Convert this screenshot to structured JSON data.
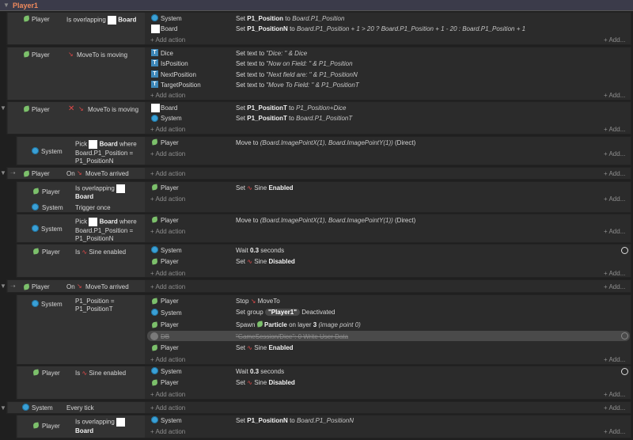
{
  "group": {
    "title": "Player1"
  },
  "common": {
    "add_action": "+ Add action",
    "add_dots": "+ Add...",
    "player": "Player",
    "system": "System",
    "board": "Board"
  },
  "ev1": {
    "cond_text": "Is overlapping",
    "cond_obj": "Board",
    "a1_obj": "System",
    "a1_pre": "Set",
    "a1_var": "P1_Position",
    "a1_mid": "to",
    "a1_val": "Board.P1_Position",
    "a2_obj": "Board",
    "a2_pre": "Set",
    "a2_var": "P1_PositionN",
    "a2_mid": "to",
    "a2_val": "Board.P1_Position + 1 > 20 ? Board.P1_Position + 1 - 20 : Board.P1_Position + 1"
  },
  "ev2": {
    "cond_text": "MoveTo is moving",
    "rows": [
      {
        "obj": "Dice",
        "pre": "Set text to",
        "val": "\"Dice: \" & Dice"
      },
      {
        "obj": "IsPosition",
        "pre": "Set text to",
        "val": "\"Now on Field: \" & P1_Position"
      },
      {
        "obj": "NextPosition",
        "pre": "Set text to",
        "val": "\"Next field are: \" & P1_PositionN"
      },
      {
        "obj": "TargetPosition",
        "pre": "Set text to",
        "val": "\"Move To Field: \" & P1_PositionT"
      }
    ]
  },
  "ev3": {
    "cond_text": "MoveTo is moving",
    "a1_obj": "Board",
    "a1_pre": "Set",
    "a1_var": "P1_PositionT",
    "a1_mid": "to",
    "a1_val": "P1_Position+Dice",
    "a2_obj": "System",
    "a2_pre": "Set",
    "a2_var": "P1_PositionT",
    "a2_mid": "to",
    "a2_val": "Board.P1_PositionT"
  },
  "ev4": {
    "pick": "Pick",
    "where": "where",
    "cond_line2": "Board.P1_Position =",
    "cond_line3": "P1_PositionN",
    "a1_pre": "Move to",
    "a1_val": "(Board.ImagePointX(1), Board.ImagePointY(1))",
    "a1_post": "(Direct)"
  },
  "ev5": {
    "on": "On",
    "cond_text": "MoveTo arrived"
  },
  "ev6": {
    "cond1_text": "Is overlapping",
    "cond2_text": "Trigger once",
    "a1_pre": "Set",
    "a1_obj": "Sine",
    "a1_state": "Enabled"
  },
  "ev7": {
    "pick": "Pick",
    "where": "where",
    "cond_line2": "Board.P1_Position =",
    "cond_line3": "P1_PositionN",
    "a1_pre": "Move to",
    "a1_val": "(Board.ImagePointX(1), Board.ImagePointY(1))",
    "a1_post": "(Direct)"
  },
  "ev8": {
    "is": "Is",
    "cond_text": "Sine enabled",
    "a1_pre": "Wait",
    "a1_val": "0.3",
    "a1_post": "seconds",
    "a2_pre": "Set",
    "a2_obj": "Sine",
    "a2_state": "Disabled"
  },
  "ev9": {
    "on": "On",
    "cond_text": "MoveTo arrived"
  },
  "ev10": {
    "cond_line1": "P1_Position =",
    "cond_line2": "P1_PositionT",
    "a1_pre": "Stop",
    "a1_obj": "MoveTo",
    "a2_pre": "Set group",
    "a2_group": "\"Player1\"",
    "a2_post": "Deactivated",
    "a3_pre": "Spawn",
    "a3_obj": "Particle",
    "a3_mid": "on layer",
    "a3_layer": "3",
    "a3_post": "(image point 0)",
    "a4_obj": "DB",
    "a4_val": "\"GameSession/Dice\": 0 Write User Data",
    "a5_pre": "Set",
    "a5_obj": "Sine",
    "a5_state": "Enabled"
  },
  "ev11": {
    "is": "Is",
    "cond_text": "Sine enabled",
    "a1_pre": "Wait",
    "a1_val": "0.3",
    "a1_post": "seconds",
    "a2_pre": "Set",
    "a2_obj": "Sine",
    "a2_state": "Disabled"
  },
  "ev12": {
    "cond_text": "Every tick"
  },
  "ev13": {
    "cond_text": "Is overlapping",
    "a1_pre": "Set",
    "a1_var": "P1_PositionN",
    "a1_mid": "to",
    "a1_val": "Board.P1_PositionN"
  }
}
